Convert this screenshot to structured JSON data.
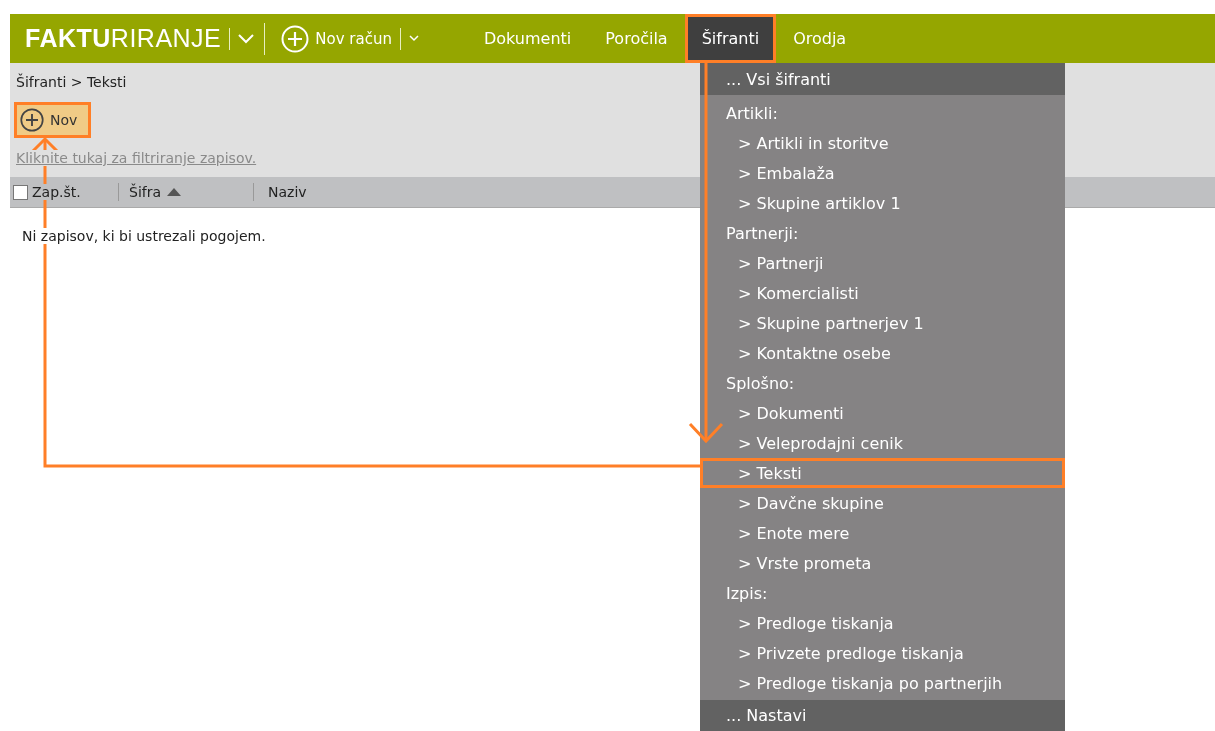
{
  "app": {
    "logo": "**FAKTU**RIRANJE",
    "new_invoice": "Nov račun"
  },
  "nav": [
    {
      "label": "Dokumenti",
      "selected": false,
      "highlighted": false
    },
    {
      "label": "Poročila",
      "selected": false,
      "highlighted": false
    },
    {
      "label": "Šifranti",
      "selected": true,
      "highlighted": true
    },
    {
      "label": "Orodja",
      "selected": false,
      "highlighted": false
    }
  ],
  "breadcrumb": "Šifranti > Teksti",
  "toolbar": {
    "new_button": {
      "label": "Nov",
      "highlighted": true
    }
  },
  "filter_link": "Kliknite tukaj za filtriranje zapisov.",
  "table": {
    "select_all": {
      "checked": false
    },
    "columns": [
      {
        "label": "Zap.št.",
        "sorted_ascending": false
      },
      {
        "label": "Šifra",
        "sorted_ascending": true
      },
      {
        "label": "Naziv",
        "sorted_ascending": false
      }
    ],
    "empty_message": "Ni zapisov, ki bi ustrezali pogojem."
  },
  "dropdown": {
    "top": "... Vsi šifranti",
    "groups": [
      {
        "label": "Artikli:",
        "items": [
          {
            "label": "> Artikli in storitve",
            "highlighted": false
          },
          {
            "label": "> Embalaža",
            "highlighted": false
          },
          {
            "label": "> Skupine artiklov 1",
            "highlighted": false
          }
        ]
      },
      {
        "label": "Partnerji:",
        "items": [
          {
            "label": "> Partnerji",
            "highlighted": false
          },
          {
            "label": "> Komercialisti",
            "highlighted": false
          },
          {
            "label": "> Skupine partnerjev 1",
            "highlighted": false
          },
          {
            "label": "> Kontaktne osebe",
            "highlighted": false
          }
        ]
      },
      {
        "label": "Splošno:",
        "items": [
          {
            "label": "> Dokumenti",
            "highlighted": false
          },
          {
            "label": "> Veleprodajni cenik",
            "highlighted": false
          },
          {
            "label": "> Teksti",
            "highlighted": true
          },
          {
            "label": "> Davčne skupine",
            "highlighted": false
          },
          {
            "label": "> Enote mere",
            "highlighted": false
          },
          {
            "label": "> Vrste prometa",
            "highlighted": false
          }
        ]
      },
      {
        "label": "Izpis:",
        "items": [
          {
            "label": "> Predloge tiskanja",
            "highlighted": false
          },
          {
            "label": "> Privzete predloge tiskanja",
            "highlighted": false
          },
          {
            "label": "> Predloge tiskanja po partnerjih",
            "highlighted": false
          }
        ]
      }
    ],
    "bottom": "... Nastavi"
  }
}
